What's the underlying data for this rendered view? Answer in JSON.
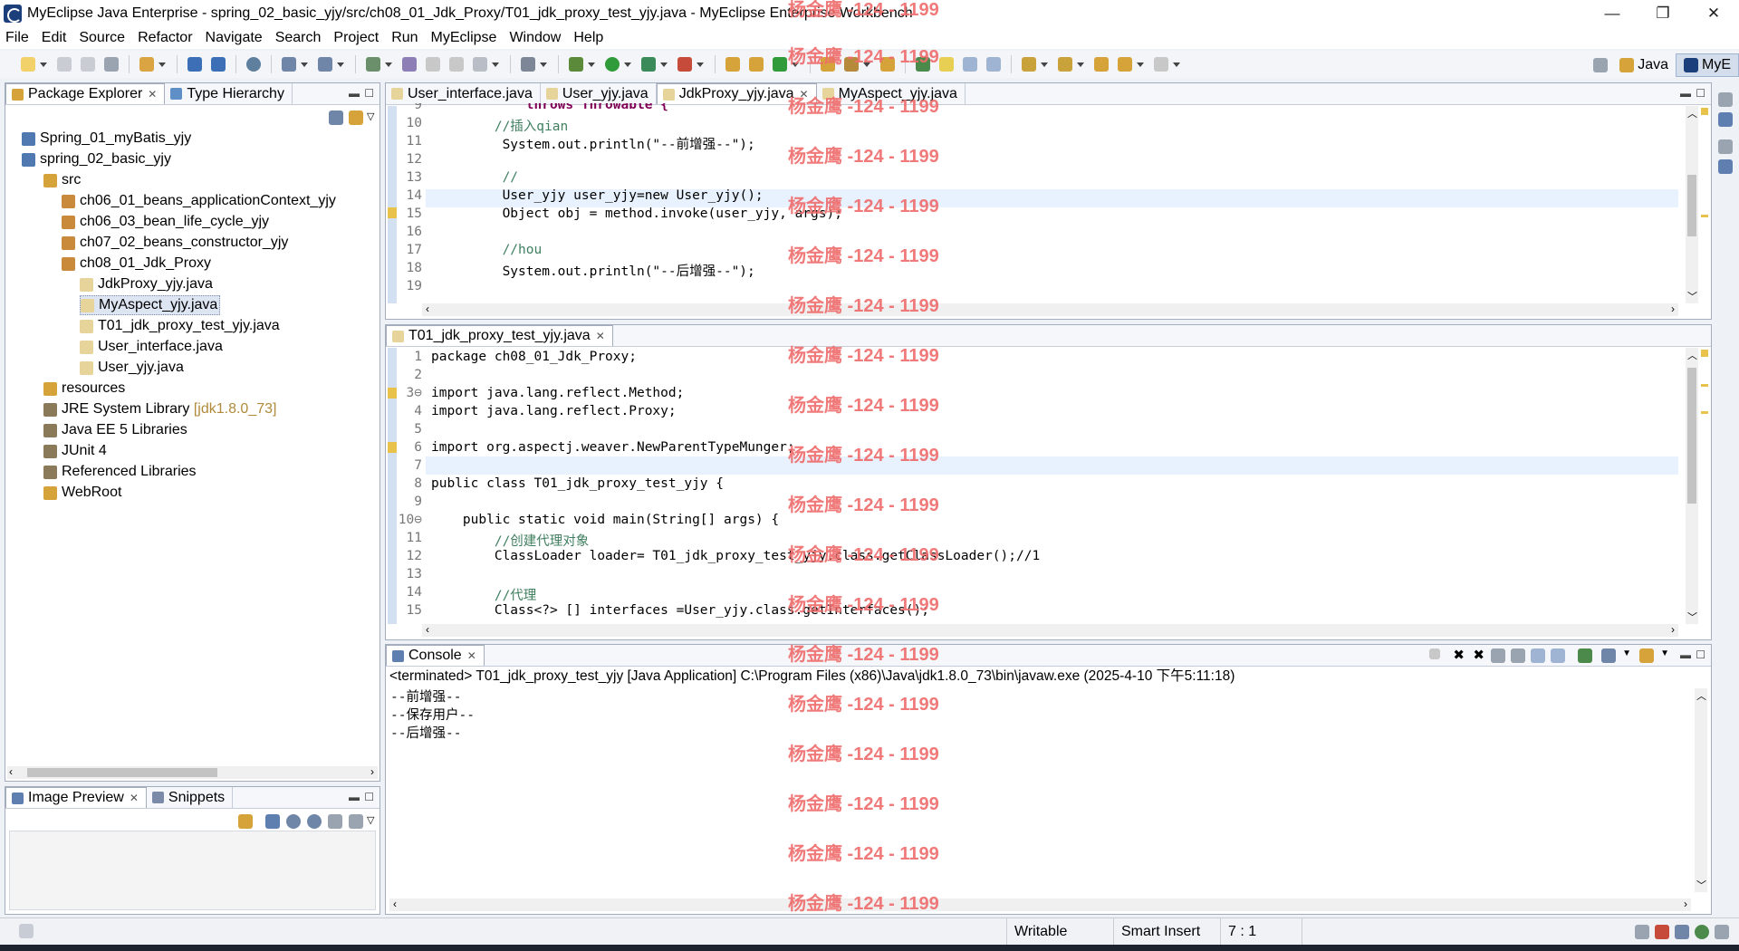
{
  "window": {
    "title": "MyEclipse Java Enterprise - spring_02_basic_yjy/src/ch08_01_Jdk_Proxy/T01_jdk_proxy_test_yjy.java - MyEclipse Enterprise Workbench",
    "minimize": "—",
    "restore": "❐",
    "close": "✕"
  },
  "menu": [
    "File",
    "Edit",
    "Source",
    "Refactor",
    "Navigate",
    "Search",
    "Project",
    "Run",
    "MyEclipse",
    "Window",
    "Help"
  ],
  "perspectives": [
    "Java",
    "MyE"
  ],
  "package_explorer": {
    "tabs": [
      "Package Explorer",
      "Type Hierarchy"
    ],
    "tree": [
      {
        "label": "Spring_01_myBatis_yjy",
        "extra": ""
      },
      {
        "label": "spring_02_basic_yjy",
        "extra": ""
      },
      {
        "label": "src",
        "extra": ""
      },
      {
        "label": "ch06_01_beans_applicationContext_yjy",
        "extra": ""
      },
      {
        "label": "ch06_03_bean_life_cycle_yjy",
        "extra": ""
      },
      {
        "label": "ch07_02_beans_constructor_yjy",
        "extra": ""
      },
      {
        "label": "ch08_01_Jdk_Proxy",
        "extra": ""
      },
      {
        "label": "JdkProxy_yjy.java",
        "extra": ""
      },
      {
        "label": "MyAspect_yjy.java",
        "extra": ""
      },
      {
        "label": "T01_jdk_proxy_test_yjy.java",
        "extra": ""
      },
      {
        "label": "User_interface.java",
        "extra": ""
      },
      {
        "label": "User_yjy.java",
        "extra": ""
      },
      {
        "label": "resources",
        "extra": ""
      },
      {
        "label": "JRE System Library",
        "extra": "[jdk1.8.0_73]"
      },
      {
        "label": "Java EE 5 Libraries",
        "extra": ""
      },
      {
        "label": "JUnit 4",
        "extra": ""
      },
      {
        "label": "Referenced Libraries",
        "extra": ""
      },
      {
        "label": "WebRoot",
        "extra": ""
      }
    ]
  },
  "image_preview": {
    "tabs": [
      "Image Preview",
      "Snippets"
    ]
  },
  "top_editor": {
    "tabs": [
      "User_interface.java",
      "User_yjy.java",
      "JdkProxy_yjy.java",
      "MyAspect_yjy.java"
    ],
    "lines": [
      {
        "n": "9",
        "text": "            throws Throwable {"
      },
      {
        "n": "10",
        "text": "        //插入qian"
      },
      {
        "n": "11",
        "text": "         System.out.println(\"--前增强--\");"
      },
      {
        "n": "12",
        "text": ""
      },
      {
        "n": "13",
        "text": "         //"
      },
      {
        "n": "14",
        "text": "         User_yjy user_yjy=new User_yjy();"
      },
      {
        "n": "15",
        "text": "         Object obj = method.invoke(user_yjy, args);"
      },
      {
        "n": "16",
        "text": ""
      },
      {
        "n": "17",
        "text": "         //hou"
      },
      {
        "n": "18",
        "text": "         System.out.println(\"--后增强--\");"
      },
      {
        "n": "19",
        "text": ""
      }
    ]
  },
  "bottom_editor": {
    "tab": "T01_jdk_proxy_test_yjy.java",
    "lines": [
      {
        "n": "1",
        "text": "package ch08_01_Jdk_Proxy;"
      },
      {
        "n": "2",
        "text": ""
      },
      {
        "n": "3⊖",
        "text": "import java.lang.reflect.Method;"
      },
      {
        "n": "4",
        "text": "import java.lang.reflect.Proxy;"
      },
      {
        "n": "5",
        "text": ""
      },
      {
        "n": "6",
        "text": "import org.aspectj.weaver.NewParentTypeMunger;"
      },
      {
        "n": "7",
        "text": ""
      },
      {
        "n": "8",
        "text": "public class T01_jdk_proxy_test_yjy {"
      },
      {
        "n": "9",
        "text": ""
      },
      {
        "n": "10⊖",
        "text": "    public static void main(String[] args) {"
      },
      {
        "n": "11",
        "text": "        //创建代理对象"
      },
      {
        "n": "12",
        "text": "        ClassLoader loader= T01_jdk_proxy_test_yjy.class.getClassLoader();//1"
      },
      {
        "n": "13",
        "text": ""
      },
      {
        "n": "14",
        "text": "        //代理"
      },
      {
        "n": "15",
        "text": "        Class<?> [] interfaces =User_yjy.class.getInterfaces();"
      }
    ]
  },
  "console": {
    "tab": "Console",
    "header": "<terminated> T01_jdk_proxy_test_yjy [Java Application] C:\\Program Files (x86)\\Java\\jdk1.8.0_73\\bin\\javaw.exe (2025-4-10 下午5:11:18)",
    "output": [
      "--前增强--",
      "--保存用户--",
      "--后增强--"
    ]
  },
  "status": {
    "writable": "Writable",
    "insert": "Smart Insert",
    "position": "7 : 1"
  },
  "watermark": "杨金鹰 -124 - 1199",
  "colors": {
    "keyword": "#7f0055",
    "comment": "#3f7f5f",
    "string": "#2a00ff",
    "watermark": "#ef6b6b"
  }
}
